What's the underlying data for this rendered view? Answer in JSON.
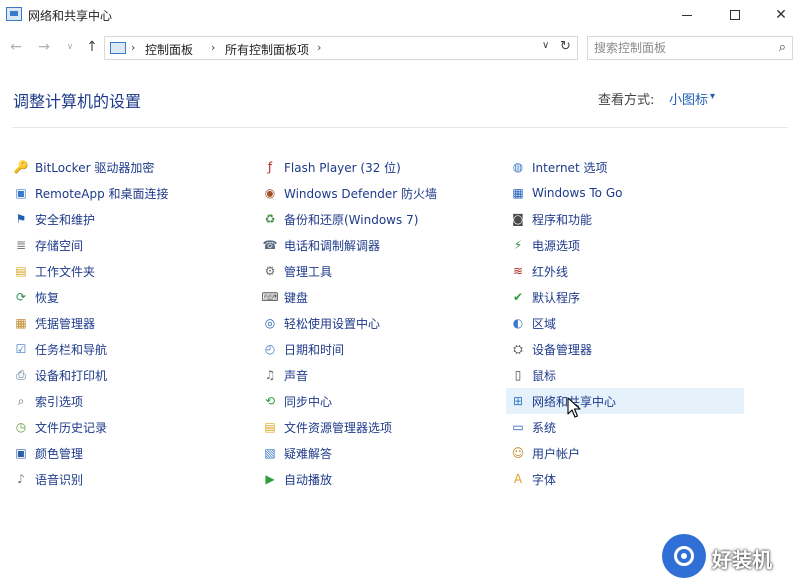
{
  "window": {
    "title": "网络和共享中心",
    "minimize_glyph": "",
    "maximize_glyph": "",
    "close_glyph": "✕"
  },
  "nav": {
    "back_glyph": "←",
    "forward_glyph": "→",
    "history_glyph": "∨",
    "up_glyph": "↑",
    "breadcrumb": [
      "控制面板",
      "所有控制面板项"
    ],
    "breadcrumb_sep": "›",
    "dropdown_glyph": "∨",
    "refresh_glyph": "↻",
    "search_placeholder": "搜索控制面板",
    "search_glyph": "⌕"
  },
  "header": {
    "title": "调整计算机的设置",
    "view_by_label": "查看方式:",
    "view_by_value": "小图标",
    "view_by_caret": "▾"
  },
  "items": {
    "col1": [
      {
        "label": "BitLocker 驱动器加密",
        "icon": "bitlocker-icon",
        "glyph": "🔑",
        "color": "#b8860b"
      },
      {
        "label": "RemoteApp 和桌面连接",
        "icon": "remoteapp-icon",
        "glyph": "▣",
        "color": "#3a78c9"
      },
      {
        "label": "安全和维护",
        "icon": "flag-icon",
        "glyph": "⚑",
        "color": "#1e5fb5"
      },
      {
        "label": "存储空间",
        "icon": "storage-icon",
        "glyph": "≣",
        "color": "#7a7a7a"
      },
      {
        "label": "工作文件夹",
        "icon": "work-folder-icon",
        "glyph": "▤",
        "color": "#d9a520"
      },
      {
        "label": "恢复",
        "icon": "recovery-icon",
        "glyph": "⟳",
        "color": "#2e8b57"
      },
      {
        "label": "凭据管理器",
        "icon": "credential-icon",
        "glyph": "▦",
        "color": "#c28a2c"
      },
      {
        "label": "任务栏和导航",
        "icon": "taskbar-icon",
        "glyph": "☑",
        "color": "#3a78c9"
      },
      {
        "label": "设备和打印机",
        "icon": "printer-icon",
        "glyph": "⎙",
        "color": "#4a6e8a"
      },
      {
        "label": "索引选项",
        "icon": "index-icon",
        "glyph": "⌕",
        "color": "#6a6a6a"
      },
      {
        "label": "文件历史记录",
        "icon": "file-history-icon",
        "glyph": "◷",
        "color": "#5a9e2f"
      },
      {
        "label": "颜色管理",
        "icon": "color-mgmt-icon",
        "glyph": "▣",
        "color": "#2b5fa8"
      },
      {
        "label": "语音识别",
        "icon": "microphone-icon",
        "glyph": "♪",
        "color": "#7a7a7a"
      }
    ],
    "col2": [
      {
        "label": "Flash Player (32 位)",
        "icon": "flash-icon",
        "glyph": "ƒ",
        "color": "#b3261e"
      },
      {
        "label": "Windows Defender 防火墙",
        "icon": "firewall-icon",
        "glyph": "◉",
        "color": "#a0522d"
      },
      {
        "label": "备份和还原(Windows 7)",
        "icon": "backup-icon",
        "glyph": "♻",
        "color": "#3f8f3f"
      },
      {
        "label": "电话和调制解调器",
        "icon": "phone-modem-icon",
        "glyph": "☎",
        "color": "#5a6e82"
      },
      {
        "label": "管理工具",
        "icon": "admin-tools-icon",
        "glyph": "⚙",
        "color": "#6a6a6a"
      },
      {
        "label": "键盘",
        "icon": "keyboard-icon",
        "glyph": "⌨",
        "color": "#5a5a5a"
      },
      {
        "label": "轻松使用设置中心",
        "icon": "ease-access-icon",
        "glyph": "◎",
        "color": "#1e5fb5"
      },
      {
        "label": "日期和时间",
        "icon": "clock-icon",
        "glyph": "◴",
        "color": "#3a78c9"
      },
      {
        "label": "声音",
        "icon": "speaker-icon",
        "glyph": "♫",
        "color": "#6a6a6a"
      },
      {
        "label": "同步中心",
        "icon": "sync-icon",
        "glyph": "⟲",
        "color": "#2e9e3e"
      },
      {
        "label": "文件资源管理器选项",
        "icon": "folder-options-icon",
        "glyph": "▤",
        "color": "#d9a520"
      },
      {
        "label": "疑难解答",
        "icon": "troubleshoot-icon",
        "glyph": "▧",
        "color": "#3a78c9"
      },
      {
        "label": "自动播放",
        "icon": "autoplay-icon",
        "glyph": "▶",
        "color": "#2e9e3e"
      }
    ],
    "col3": [
      {
        "label": "Internet 选项",
        "icon": "internet-icon",
        "glyph": "◍",
        "color": "#3a78c9"
      },
      {
        "label": "Windows To Go",
        "icon": "windows-to-go-icon",
        "glyph": "▦",
        "color": "#1e5fb5"
      },
      {
        "label": "程序和功能",
        "icon": "programs-icon",
        "glyph": "◙",
        "color": "#4a4a4a"
      },
      {
        "label": "电源选项",
        "icon": "power-icon",
        "glyph": "⚡",
        "color": "#3f8f3f"
      },
      {
        "label": "红外线",
        "icon": "infrared-icon",
        "glyph": "≋",
        "color": "#b3261e"
      },
      {
        "label": "默认程序",
        "icon": "default-programs-icon",
        "glyph": "✔",
        "color": "#2e9e3e"
      },
      {
        "label": "区域",
        "icon": "region-icon",
        "glyph": "◐",
        "color": "#3a78c9"
      },
      {
        "label": "设备管理器",
        "icon": "device-manager-icon",
        "glyph": "⛭",
        "color": "#5a5a5a"
      },
      {
        "label": "鼠标",
        "icon": "mouse-icon",
        "glyph": "▯",
        "color": "#4a4a4a"
      },
      {
        "label": "网络和共享中心",
        "icon": "network-icon",
        "glyph": "⊞",
        "color": "#3a78c9",
        "hover": true
      },
      {
        "label": "系统",
        "icon": "system-icon",
        "glyph": "▭",
        "color": "#1e5fb5"
      },
      {
        "label": "用户帐户",
        "icon": "user-accounts-icon",
        "glyph": "☺",
        "color": "#c28a2c"
      },
      {
        "label": "字体",
        "icon": "font-icon",
        "glyph": "A",
        "color": "#d9a520"
      }
    ]
  },
  "watermark": {
    "text": "好装机"
  }
}
